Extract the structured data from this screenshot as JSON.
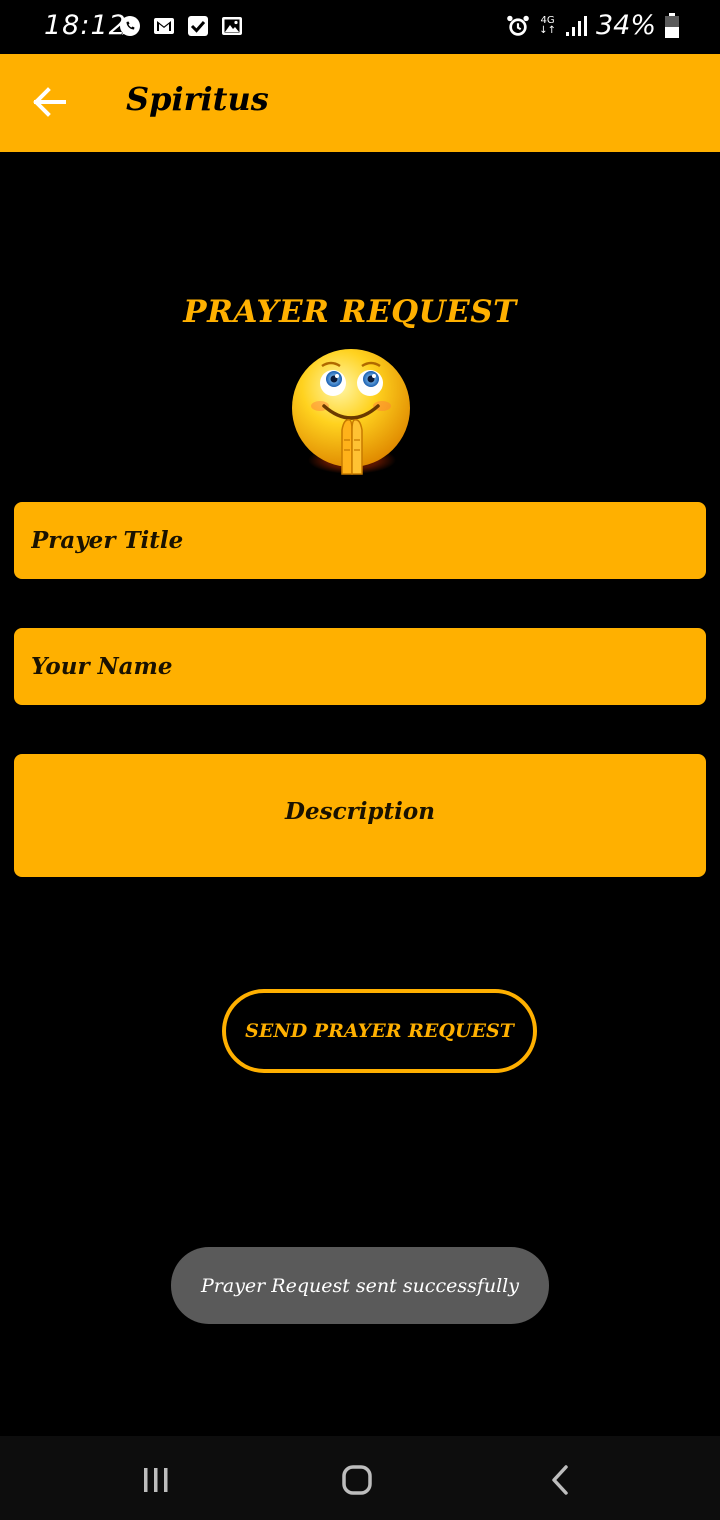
{
  "status_bar": {
    "time": "18:12",
    "network": "4G",
    "battery": "34%",
    "left_icons": [
      "whatsapp-icon",
      "gmail-icon",
      "task-check-icon",
      "gallery-icon"
    ],
    "right_icons": [
      "alarm-icon",
      "network-arrows-icon",
      "signal-icon",
      "battery-icon"
    ]
  },
  "app_bar": {
    "title": "Spiritus",
    "back_icon": "arrow-left-icon",
    "color": "#FFB000"
  },
  "main": {
    "heading": "PRAYER REQUEST",
    "emoji_icon": "praying-smiley-icon",
    "fields": {
      "title_placeholder": "Prayer Title",
      "name_placeholder": "Your Name",
      "description_placeholder": "Description"
    },
    "send_button_label": "SEND PRAYER REQUEST"
  },
  "toast": {
    "message": "Prayer Request sent successfully"
  },
  "nav_bar": {
    "icons": [
      "recents-icon",
      "home-icon",
      "back-icon"
    ]
  },
  "colors": {
    "accent": "#FFB000",
    "background": "#000000",
    "toast_bg": "#5a5a5a"
  }
}
